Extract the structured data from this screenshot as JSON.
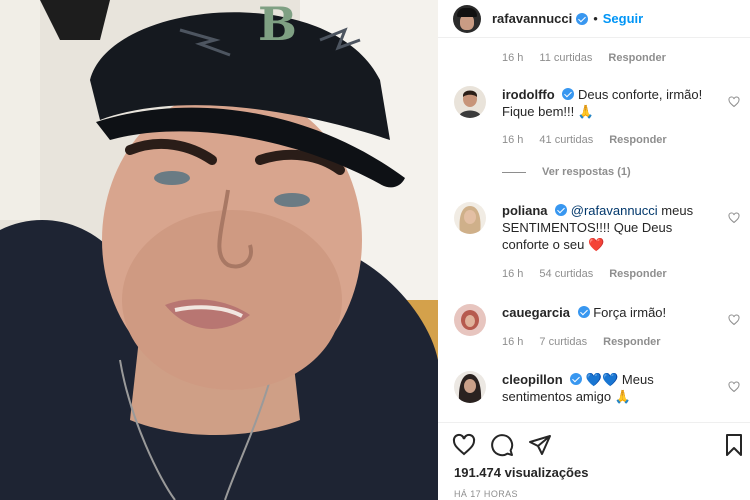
{
  "post": {
    "author": "rafavannucci",
    "follow_label": "Seguir",
    "dot": "•"
  },
  "comments": {
    "top_meta": {
      "time": "16 h",
      "likes": "11 curtidas",
      "reply": "Responder"
    },
    "items": [
      {
        "username": "irodolffo",
        "text": "Deus conforte, irmão! Fique bem!!! 🙏",
        "time": "16 h",
        "likes": "41 curtidas",
        "reply": "Responder"
      },
      {
        "username": "poliana",
        "mention": "@rafavannucci",
        "text": " meus SENTIMENTOS!!!! Que Deus conforte o seu ❤️",
        "time": "16 h",
        "likes": "54 curtidas",
        "reply": "Responder"
      },
      {
        "username": "cauegarcia",
        "text": "Força irmão!",
        "time": "16 h",
        "likes": "7 curtidas",
        "reply": "Responder"
      },
      {
        "username": "cleopillon",
        "text": "💙💙 Meus sentimentos amigo 🙏",
        "time": "",
        "likes": "",
        "reply": ""
      }
    ],
    "view_replies": "Ver respostas (1)"
  },
  "actions": {
    "views_count": "191.474",
    "views_label": "visualizações",
    "time_ago": "HÁ 17 HORAS"
  },
  "icons": {
    "like": "heart-outline-icon",
    "comment": "comment-bubble-icon",
    "share": "paper-plane-icon",
    "save": "bookmark-icon",
    "verified": "verified-badge-icon"
  },
  "colors": {
    "accent": "#0095f6",
    "verified": "#3897f0",
    "muted": "#8e8e8e",
    "text": "#262626"
  }
}
